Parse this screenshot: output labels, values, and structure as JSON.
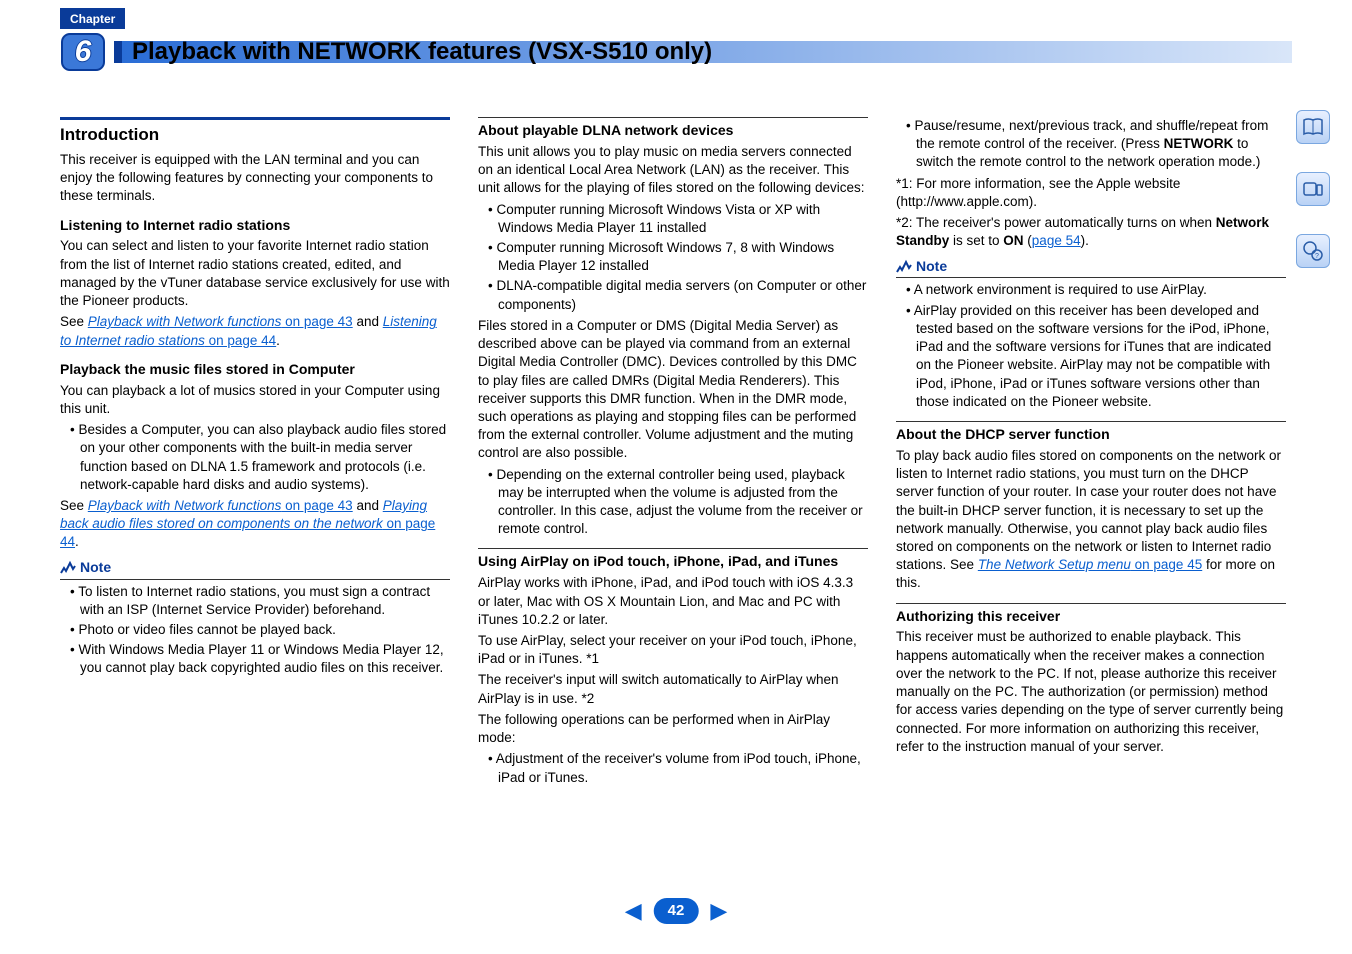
{
  "chapter_label": "Chapter",
  "chapter_number": "6",
  "chapter_title": "Playback with NETWORK features (VSX-S510 only)",
  "col1": {
    "h_intro": "Introduction",
    "p_intro": "This receiver is equipped with the LAN terminal and you can enjoy the following features by connecting your components to these terminals.",
    "h_listen": "Listening to Internet radio stations",
    "p_listen": "You can select and listen to your favorite Internet radio station from the list of Internet radio stations created, edited, and managed by the vTuner database service exclusively for use with the Pioneer products.",
    "see1_pre": "See ",
    "see1_link1": "Playback with Network functions",
    "see1_mid1": " on page 43",
    "see1_and": " and ",
    "see1_link2": "Listening to Internet radio stations",
    "see1_mid2": " on page 44",
    "see1_end": ".",
    "h_playback": "Playback the music files stored in Computer",
    "p_playback": "You can playback a lot of musics stored in your Computer using this unit.",
    "li_playback": "Besides a Computer, you can also playback audio files stored on your other components with the built-in media server function based on DLNA 1.5 framework and protocols (i.e. network-capable hard disks and audio systems).",
    "see2_pre": "See ",
    "see2_link1": "Playback with Network functions",
    "see2_mid1": " on page 43",
    "see2_and": " and ",
    "see2_link2": "Playing back audio files stored on components on the network",
    "see2_mid2": " on page 44",
    "see2_end": ".",
    "note_label": "Note",
    "note_li1": "To listen to Internet radio stations, you must sign a contract with an ISP (Internet Service Provider) beforehand.",
    "note_li2": "Photo or video files cannot be played back.",
    "note_li3": "With Windows Media Player 11 or Windows Media Player 12, you cannot play back copyrighted audio files on this receiver."
  },
  "col2": {
    "h_dlna": "About playable DLNA network devices",
    "p_dlna1": "This unit allows you to play music on media servers connected on an identical Local Area Network (LAN) as the receiver. This unit allows for the playing of files stored on the following devices:",
    "li_d1": "Computer running Microsoft Windows Vista or XP with Windows Media Player 11 installed",
    "li_d2": "Computer running Microsoft Windows 7, 8 with Windows Media Player 12 installed",
    "li_d3": "DLNA-compatible digital media servers (on Computer or other components)",
    "p_dlna2": "Files stored in a Computer or DMS (Digital Media Server) as described above can be played via command from an external Digital Media Controller (DMC). Devices controlled by this DMC to play files are called DMRs (Digital Media Renderers). This receiver supports this DMR function. When in the DMR mode, such operations as playing and stopping files can be performed from the external controller. Volume adjustment and the muting control are also possible.",
    "li_d4": "Depending on the external controller being used, playback may be interrupted when the volume is adjusted from the controller. In this case, adjust the volume from the receiver or remote control.",
    "h_airplay": "Using AirPlay on iPod touch, iPhone, iPad, and iTunes",
    "p_air1": "AirPlay works with iPhone, iPad, and iPod touch with iOS 4.3.3 or later, Mac with OS X Mountain Lion, and Mac and PC with iTunes 10.2.2 or later.",
    "p_air2": "To use AirPlay, select your receiver on your iPod touch, iPhone, iPad or in iTunes. *1",
    "p_air3": "The receiver's input will switch automatically to AirPlay when AirPlay is in use. *2",
    "p_air4": "The following operations can be performed when in AirPlay mode:",
    "li_air1": "Adjustment of the receiver's volume from iPod touch, iPhone, iPad or iTunes."
  },
  "col3": {
    "li_air2_a": "Pause/resume, next/previous track, and shuffle/repeat from the remote control of the receiver. (Press ",
    "li_air2_b": "NETWORK",
    "li_air2_c": " to switch the remote control to the network operation mode.)",
    "p_star1": "*1: For more information, see the Apple website (http://www.apple.com).",
    "p_star2_a": "*2: The receiver's power automatically turns on when ",
    "p_star2_b": "Network Standby",
    "p_star2_c": " is set to ",
    "p_star2_d": "ON",
    "p_star2_e": " (",
    "p_star2_link": "page 54",
    "p_star2_f": ").",
    "note_label": "Note",
    "note_li1": "A network environment is required to use AirPlay.",
    "note_li2": "AirPlay provided on this receiver has been developed and tested based on the software versions for the iPod, iPhone, iPad and the software versions for iTunes that are indicated on the Pioneer website. AirPlay may not be compatible with iPod, iPhone, iPad or iTunes software versions other than those indicated on the Pioneer website.",
    "h_dhcp": "About the DHCP server function",
    "p_dhcp_a": "To play back audio files stored on components on the network or listen to Internet radio stations, you must turn on the DHCP server function of your router. In case your router does not have the built-in DHCP server function, it is necessary to set up the network manually. Otherwise, you cannot play back audio files stored on components on the network or listen to Internet radio stations. See ",
    "p_dhcp_link": "The Network Setup menu",
    "p_dhcp_link2": " on page 45",
    "p_dhcp_b": " for more on this.",
    "h_auth": "Authorizing this receiver",
    "p_auth": "This receiver must be authorized to enable playback. This happens automatically when the receiver makes a connection over the network to the PC. If not, please authorize this receiver manually on the PC. The authorization (or permission) method for access varies depending on the type of server currently being connected. For more information on authorizing this receiver, refer to the instruction manual of your server."
  },
  "pager": {
    "page": "42"
  }
}
